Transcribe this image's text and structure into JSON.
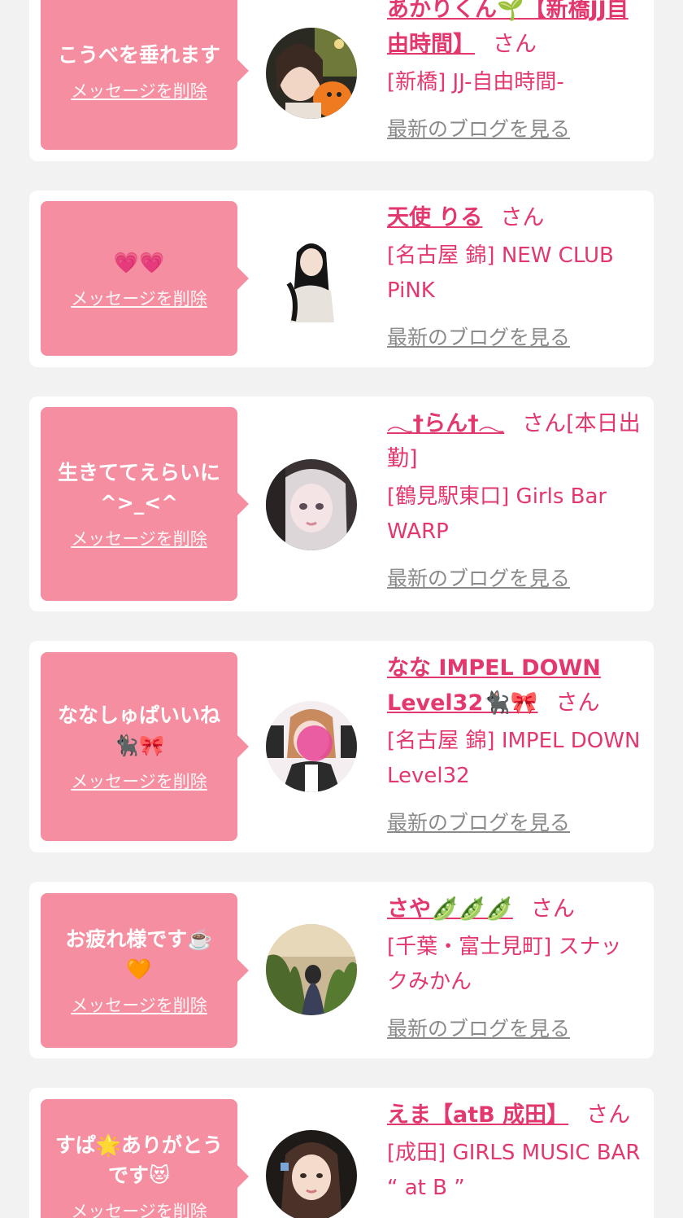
{
  "delete_label": "メッセージを削除",
  "blog_label": "最新のブログを見る",
  "san_label": "さん",
  "colors": {
    "background": "#f2f2f3",
    "bubble": "#f58ea0",
    "accent": "#e2386e",
    "link_gray": "#8a8a8a"
  },
  "messages": [
    {
      "message": "こうべを垂れます",
      "name": "あかりくん🌱【新橋JJ自由時間】",
      "shop": "[新橋] JJ-自由時間-"
    },
    {
      "message": "💗💗",
      "name": "天使 りる",
      "shop": "[名古屋 錦] NEW CLUB PiNK"
    },
    {
      "message": "生きててえらいに\n^>_<^",
      "name": "𓂃†らん†𓂃",
      "name_suffix": "[本日出勤]",
      "shop": "[鶴見駅東口] Girls Bar WARP"
    },
    {
      "message": "ななしゅぱいいね\n🐈‍⬛🎀",
      "name": "なな IMPEL DOWN Level32🐈‍⬛🎀",
      "shop": "[名古屋 錦] IMPEL DOWN Level32"
    },
    {
      "message": "お疲れ様です☕️\n🧡",
      "name": "さや🫛🫛🫛",
      "shop": "[千葉・富士見町] スナックみかん"
    },
    {
      "message": "すぱ🌟ありがとう\nです😻",
      "name": "えま【atB 成田】",
      "shop": "[成田] GIRLS MUSIC BAR “ at B ”"
    }
  ]
}
